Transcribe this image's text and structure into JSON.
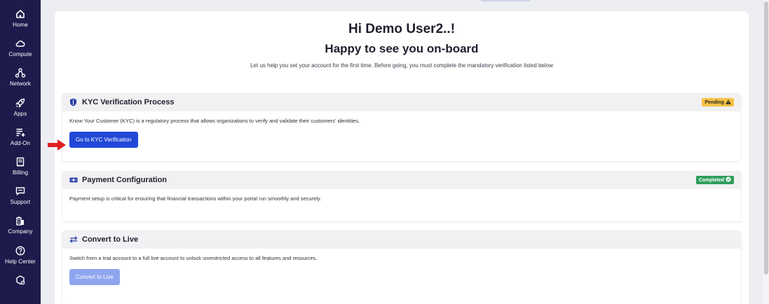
{
  "sidebar": {
    "items": [
      {
        "label": "Home",
        "icon": "home-icon"
      },
      {
        "label": "Compute",
        "icon": "cloud-icon"
      },
      {
        "label": "Network",
        "icon": "network-icon"
      },
      {
        "label": "Apps",
        "icon": "rocket-icon"
      },
      {
        "label": "Add-On",
        "icon": "add-on-icon"
      },
      {
        "label": "Billing",
        "icon": "billing-icon"
      },
      {
        "label": "Support",
        "icon": "support-icon"
      },
      {
        "label": "Company",
        "icon": "company-icon"
      },
      {
        "label": "Help Center",
        "icon": "help-icon"
      },
      {
        "label": "",
        "icon": "settings-icon"
      }
    ]
  },
  "header": {
    "greeting": "Hi Demo User2..!",
    "subtitle": "Happy to see you on-board",
    "intro": "Let us help you set your account for the first time. Before going, you must complete the mandatory verification listed below"
  },
  "cards": {
    "kyc": {
      "title": "KYC Verification Process",
      "status": "Pending",
      "description": "Know Your Customer (KYC) is a regulatory process that allows organizations to verify and validate their customers' identities.",
      "button": "Go to KYC Verification"
    },
    "payment": {
      "title": "Payment Configuration",
      "status": "Completed",
      "description": "Payment setup is critical for ensuring that financial transactions within your portal run smoothly and securely."
    },
    "live": {
      "title": "Convert to Live",
      "description": "Switch from a trial account to a full live account to unlock unrestricted access to all features and resources.",
      "button": "Convert to Live"
    }
  },
  "colors": {
    "sidebar": "#1d1b4c",
    "primary": "#2148d6",
    "pending": "#f6c343",
    "completed": "#2e9e5b",
    "arrow": "#e02020"
  }
}
